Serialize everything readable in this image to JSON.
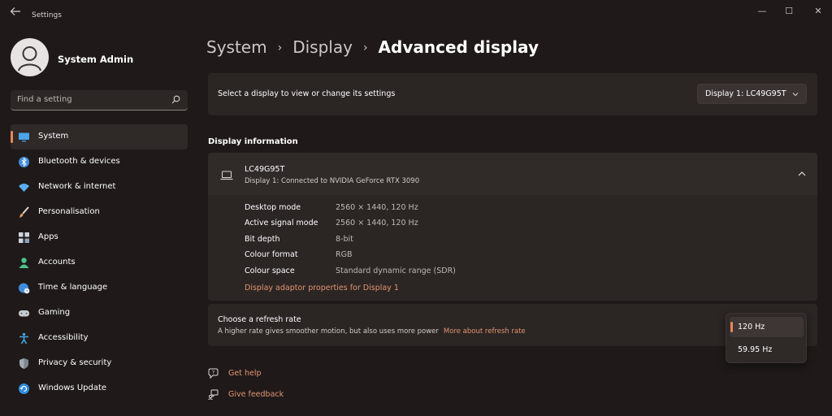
{
  "window": {
    "title": "Settings",
    "controls": {
      "minimize": "—",
      "maximize": "☐",
      "close": "✕"
    }
  },
  "user": {
    "name": "System Admin"
  },
  "search": {
    "placeholder": "Find a setting",
    "value": ""
  },
  "sidebar": {
    "items": [
      {
        "label": "System",
        "icon": "system-monitor-icon",
        "active": true
      },
      {
        "label": "Bluetooth & devices",
        "icon": "bluetooth-icon"
      },
      {
        "label": "Network & internet",
        "icon": "wifi-icon"
      },
      {
        "label": "Personalisation",
        "icon": "brush-icon"
      },
      {
        "label": "Apps",
        "icon": "apps-grid-icon"
      },
      {
        "label": "Accounts",
        "icon": "person-icon"
      },
      {
        "label": "Time & language",
        "icon": "globe-clock-icon"
      },
      {
        "label": "Gaming",
        "icon": "gamepad-icon"
      },
      {
        "label": "Accessibility",
        "icon": "accessibility-icon"
      },
      {
        "label": "Privacy & security",
        "icon": "shield-icon"
      },
      {
        "label": "Windows Update",
        "icon": "update-icon"
      }
    ]
  },
  "breadcrumb": {
    "items": [
      "System",
      "Display"
    ],
    "current": "Advanced display",
    "separator": "›"
  },
  "display_select": {
    "label": "Select a display to view or change its settings",
    "selected": "Display 1: LC49G95T"
  },
  "display_info": {
    "section_title": "Display information",
    "monitor_name": "LC49G95T",
    "monitor_subtitle": "Display 1: Connected to NVIDIA GeForce RTX 3090",
    "rows": [
      {
        "key": "Desktop mode",
        "value": "2560 × 1440, 120 Hz"
      },
      {
        "key": "Active signal mode",
        "value": "2560 × 1440, 120 Hz"
      },
      {
        "key": "Bit depth",
        "value": "8-bit"
      },
      {
        "key": "Colour format",
        "value": "RGB"
      },
      {
        "key": "Colour space",
        "value": "Standard dynamic range (SDR)"
      }
    ],
    "adapter_link": "Display adaptor properties for Display 1"
  },
  "refresh_rate": {
    "title": "Choose a refresh rate",
    "description": "A higher rate gives smoother motion, but also uses more power",
    "link": "More about refresh rate",
    "options": [
      "120 Hz",
      "59.95 Hz"
    ],
    "selected": "120 Hz"
  },
  "help_links": {
    "get_help": "Get help",
    "give_feedback": "Give feedback"
  },
  "colors": {
    "background": "#1f1a19",
    "card": "#2b2524",
    "accent": "#e8855a",
    "link": "#e39570"
  }
}
